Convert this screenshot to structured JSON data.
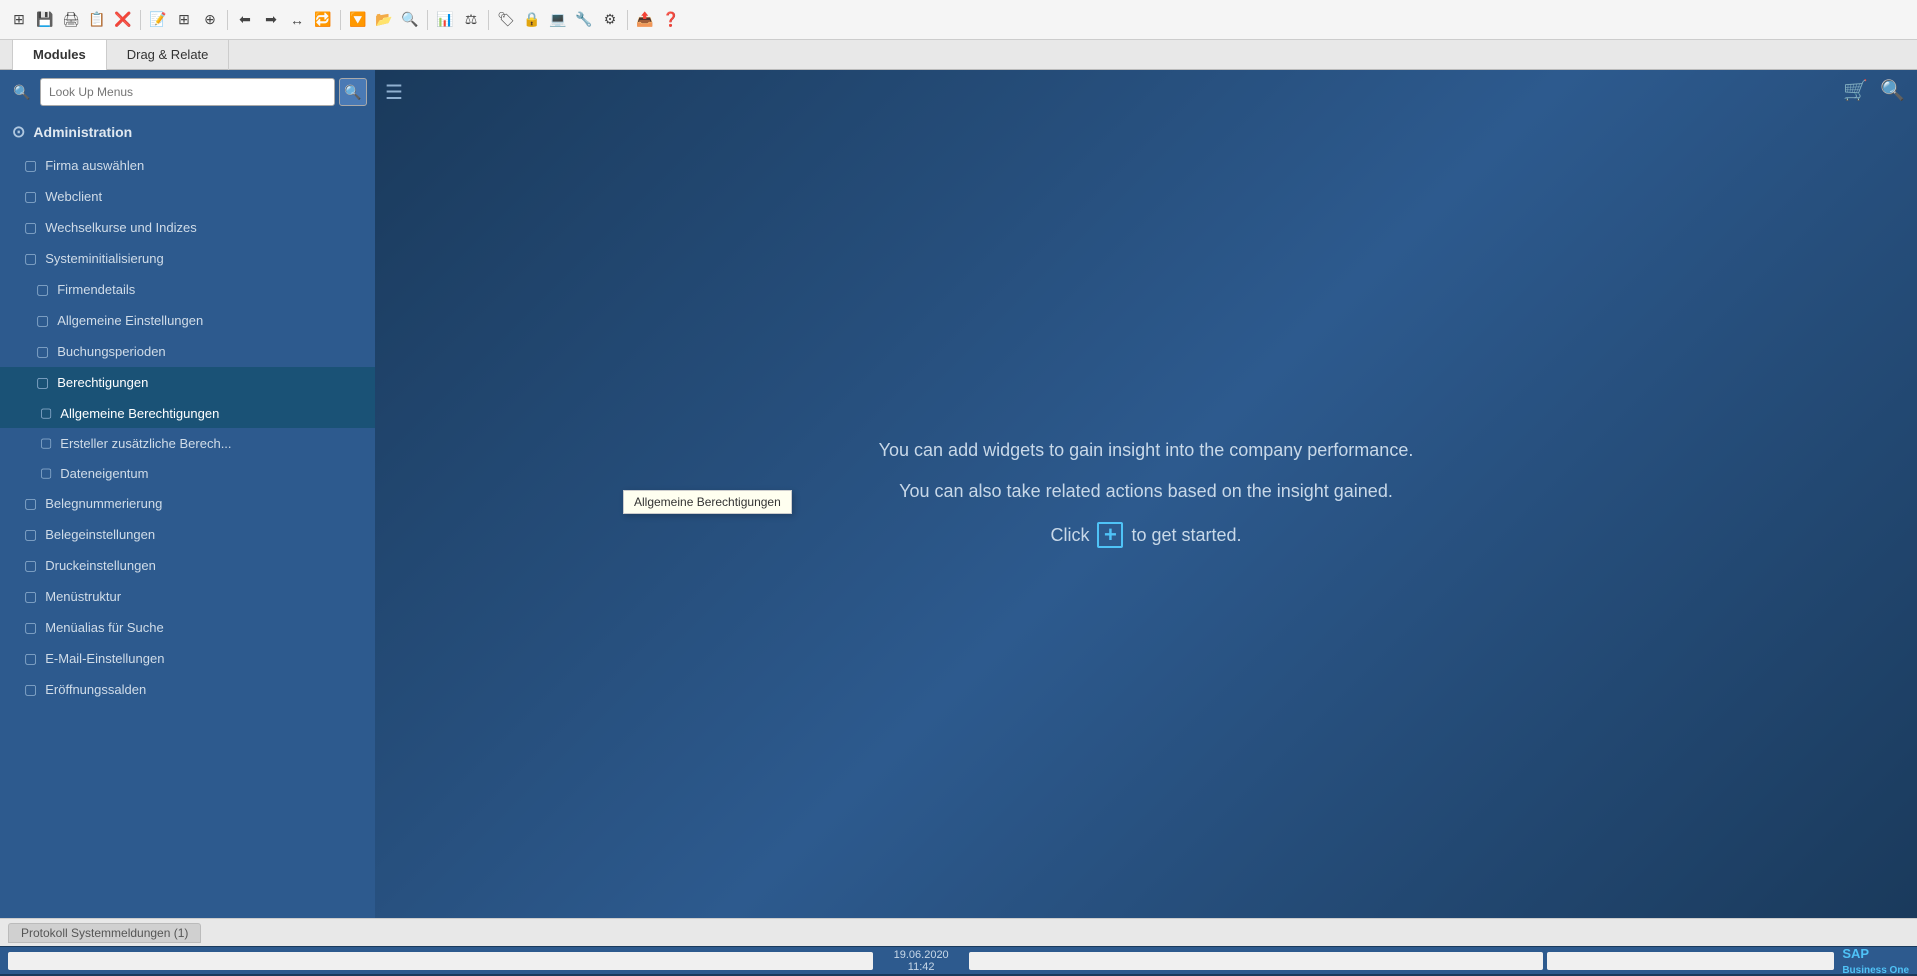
{
  "toolbar": {
    "icons": [
      "⊞",
      "💾",
      "🖨",
      "📋",
      "❌",
      "📝",
      "☰",
      "⊕",
      "⬅",
      "➡",
      "↔",
      "🔁",
      "🔽",
      "📂",
      "🔍",
      "📊",
      "⚖",
      "🏷",
      "🔒",
      "💻",
      "🔧",
      "⚙",
      "📤",
      "❓"
    ]
  },
  "module_tabs": {
    "tabs": [
      {
        "label": "Modules",
        "active": true
      },
      {
        "label": "Drag & Relate",
        "active": false
      }
    ]
  },
  "sidebar": {
    "search_placeholder": "Look Up Menus",
    "administration_label": "Administration",
    "menu_items": [
      {
        "label": "Firma auswählen",
        "level": 1,
        "active": false
      },
      {
        "label": "Webclient",
        "level": 1,
        "active": false
      },
      {
        "label": "Wechselkurse und Indizes",
        "level": 1,
        "active": false
      },
      {
        "label": "Systeminitialisierung",
        "level": 1,
        "active": false
      },
      {
        "label": "Firmendetails",
        "level": 2,
        "active": false
      },
      {
        "label": "Allgemeine Einstellungen",
        "level": 2,
        "active": false
      },
      {
        "label": "Buchungsperioden",
        "level": 2,
        "active": false
      },
      {
        "label": "Berechtigungen",
        "level": 2,
        "active": true
      },
      {
        "label": "Allgemeine Berechtigungen",
        "level": 3,
        "active": true
      },
      {
        "label": "Ersteller zusätzliche Berech...",
        "level": 3,
        "active": false
      },
      {
        "label": "Dateneigentum",
        "level": 3,
        "active": false
      },
      {
        "label": "Belegnummerierung",
        "level": 1,
        "active": false
      },
      {
        "label": "Belegeinstellungen",
        "level": 1,
        "active": false
      },
      {
        "label": "Druckeinstellungen",
        "level": 1,
        "active": false
      },
      {
        "label": "Menüstruktur",
        "level": 1,
        "active": false
      },
      {
        "label": "Menüalias für Suche",
        "level": 1,
        "active": false
      },
      {
        "label": "E-Mail-Einstellungen",
        "level": 1,
        "active": false
      },
      {
        "label": "Eröffnungssalden",
        "level": 1,
        "active": false
      }
    ]
  },
  "content": {
    "line1": "You can add widgets to gain insight into the company performance.",
    "line2": "You can also take related actions based on the insight gained.",
    "click_text_before": "Click",
    "click_text_after": "to get started."
  },
  "right_icons": {
    "cart_icon": "🛒",
    "search_icon": "🔍"
  },
  "status_bar": {
    "tab_label": "Protokoll Systemmeldungen (1)"
  },
  "bottom_bar": {
    "date": "19.06.2020",
    "time": "11:42",
    "sap_label": "SAP One"
  },
  "tooltip": {
    "text": "Allgemeine Berechtigungen"
  }
}
